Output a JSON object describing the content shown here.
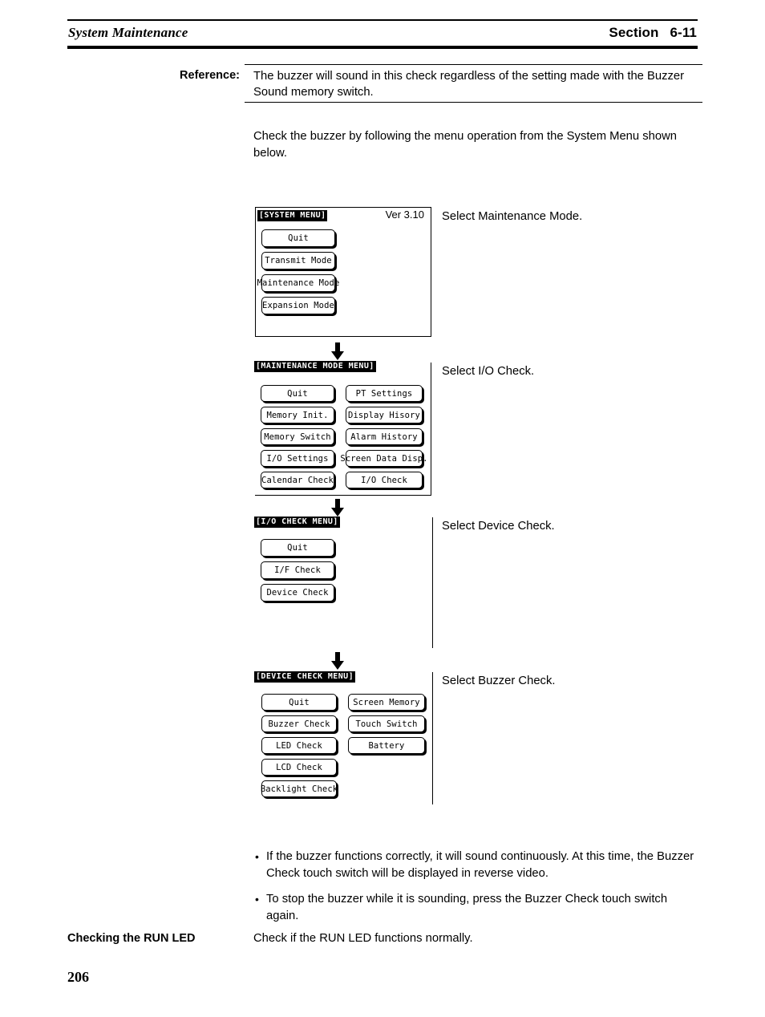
{
  "header": {
    "left_title": "System Maintenance",
    "section_label": "Section",
    "section_number": "6-11"
  },
  "reference": {
    "label": "Reference:",
    "text": "The buzzer will sound in this check regardless of the setting made with the Buzzer Sound memory switch."
  },
  "intro": {
    "text": "Check the buzzer by following the menu operation from the System Menu shown below."
  },
  "flow": {
    "screens": [
      {
        "id": "system-menu",
        "title": "[SYSTEM MENU]",
        "version": "Ver 3.10",
        "left_buttons": [
          "Quit",
          "Transmit Mode",
          "Maintenance Mode",
          "Expansion Mode"
        ],
        "right_buttons": [],
        "note": "Select Maintenance Mode."
      },
      {
        "id": "maintenance-mode-menu",
        "title": "[MAINTENANCE MODE MENU]",
        "version": "",
        "left_buttons": [
          "Quit",
          "Memory Init.",
          "Memory Switch",
          "I/O Settings",
          "Calendar Check"
        ],
        "right_buttons": [
          "PT Settings",
          "Display Hisory",
          "Alarm History",
          "Screen Data Disp.",
          "I/O Check"
        ],
        "note": "Select I/O Check."
      },
      {
        "id": "io-check-menu",
        "title": "[I/O CHECK MENU]",
        "version": "",
        "left_buttons": [
          "Quit",
          "I/F Check",
          "Device Check"
        ],
        "right_buttons": [],
        "note": "Select Device Check."
      },
      {
        "id": "device-check-menu",
        "title": "[DEVICE CHECK MENU]",
        "version": "",
        "left_buttons": [
          "Quit",
          "Buzzer Check",
          "LED Check",
          "LCD Check",
          "Backlight Check"
        ],
        "right_buttons": [
          "Screen Memory",
          "Touch Switch",
          "Battery"
        ],
        "note": "Select Buzzer Check."
      }
    ]
  },
  "bullets": [
    "If the buzzer functions correctly, it will sound continuously. At this time, the Buzzer Check touch switch will be displayed in reverse video.",
    "To stop the buzzer while it is sounding, press the Buzzer Check touch switch again."
  ],
  "bullet_marker": "•",
  "run_led": {
    "heading": "Checking the RUN LED",
    "text": "Check if the RUN LED functions normally."
  },
  "page_number": "206"
}
